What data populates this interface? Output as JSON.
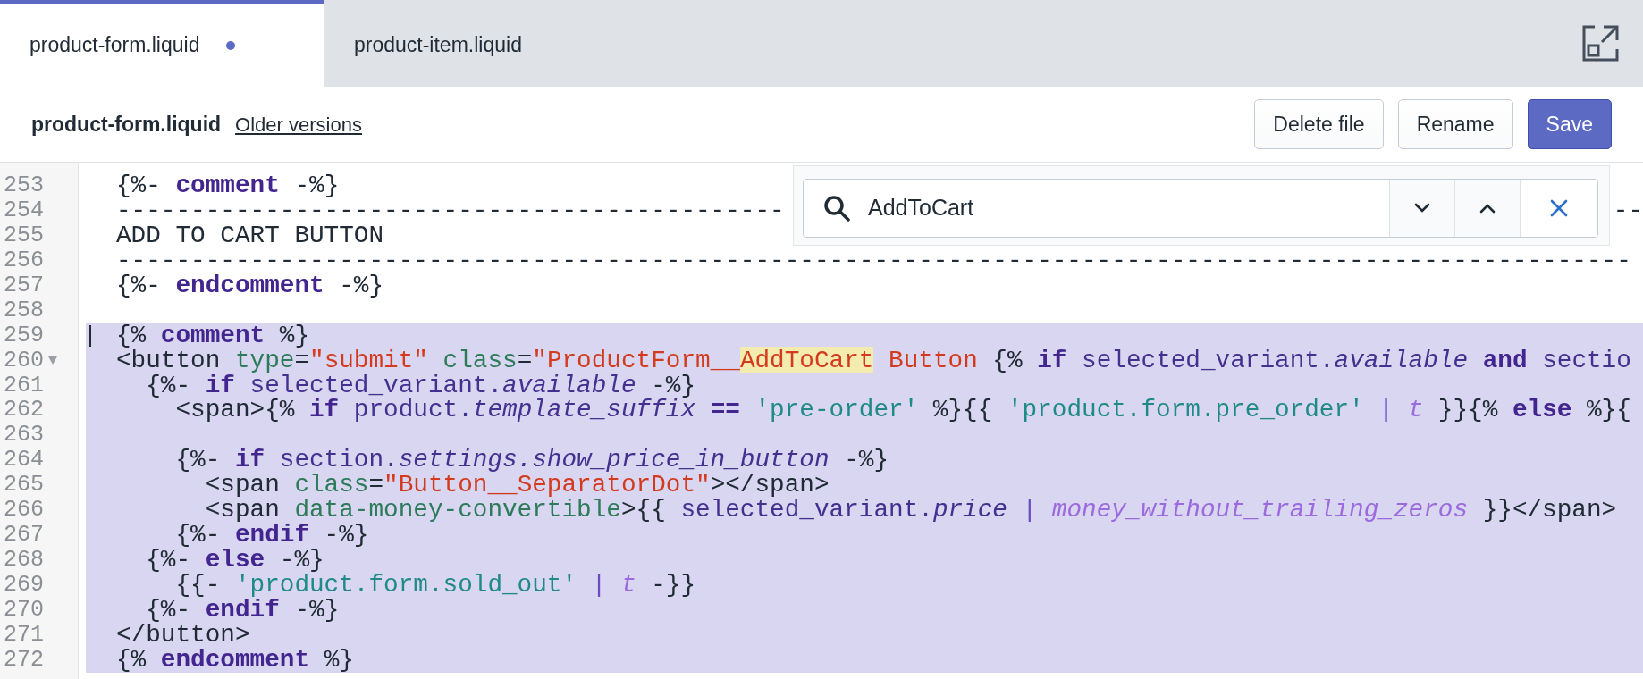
{
  "tabs": [
    {
      "label": "product-form.liquid",
      "selected": true,
      "modified": true
    },
    {
      "label": "product-item.liquid",
      "selected": false,
      "modified": false
    }
  ],
  "header": {
    "title": "product-form.liquid",
    "link": "Older versions",
    "buttons": [
      {
        "label": "Delete file",
        "kind": "secondary"
      },
      {
        "label": "Rename",
        "kind": "secondary"
      },
      {
        "label": "Save",
        "kind": "primary"
      }
    ]
  },
  "search": {
    "value": "AddToCart"
  },
  "lines": [
    {
      "number": "253",
      "selected": false,
      "fold": false,
      "cursor": false,
      "tokens": [
        {
          "kind": "plain",
          "t": "{%- "
        },
        {
          "kind": "kw",
          "t": "comment"
        },
        {
          "kind": "plain",
          "t": " -%}"
        }
      ]
    },
    {
      "number": "254",
      "selected": false,
      "fold": false,
      "cursor": false,
      "tokens": [
        {
          "kind": "plain",
          "t": "---------------------------------------------"
        },
        {
          "kind": "tail",
          "t": "--"
        }
      ]
    },
    {
      "number": "255",
      "selected": false,
      "fold": false,
      "cursor": false,
      "tokens": [
        {
          "kind": "plain",
          "t": "ADD TO CART BUTTON"
        }
      ]
    },
    {
      "number": "256",
      "selected": false,
      "fold": false,
      "cursor": false,
      "tokens": [
        {
          "kind": "plain",
          "t": "------------------------------------------------------------------------------------------------------"
        }
      ]
    },
    {
      "number": "257",
      "selected": false,
      "fold": false,
      "cursor": false,
      "tokens": [
        {
          "kind": "plain",
          "t": "{%- "
        },
        {
          "kind": "kw",
          "t": "endcomment"
        },
        {
          "kind": "plain",
          "t": " -%}"
        }
      ]
    },
    {
      "number": "258",
      "selected": false,
      "fold": false,
      "cursor": false
    },
    {
      "number": "259",
      "selected": true,
      "fold": false,
      "cursor": true,
      "tokens": [
        {
          "kind": "plain",
          "t": "{% "
        },
        {
          "kind": "kw",
          "t": "comment"
        },
        {
          "kind": "plain",
          "t": " %}"
        }
      ]
    },
    {
      "number": "260",
      "selected": true,
      "fold": true,
      "cursor": false,
      "tokens": [
        {
          "kind": "plain",
          "t": "<button "
        },
        {
          "kind": "attr",
          "t": "type"
        },
        {
          "kind": "plain",
          "t": "="
        },
        {
          "kind": "str",
          "t": "\"submit\" "
        },
        {
          "kind": "attr",
          "t": "class"
        },
        {
          "kind": "plain",
          "t": "="
        },
        {
          "kind": "str",
          "t": "\"ProductForm__"
        },
        {
          "kind": "match",
          "t": "AddToCart"
        },
        {
          "kind": "str",
          "t": " Button "
        },
        {
          "kind": "plain",
          "t": "{% "
        },
        {
          "kind": "kw",
          "t": "if"
        },
        {
          "kind": "var",
          "t": " selected_variant."
        },
        {
          "kind": "prop",
          "t": "available "
        },
        {
          "kind": "kw",
          "t": "and"
        },
        {
          "kind": "var",
          "t": " sectio"
        }
      ]
    },
    {
      "number": "261",
      "selected": true,
      "fold": false,
      "cursor": false,
      "tokens": [
        {
          "kind": "plain",
          "t": "  {%- "
        },
        {
          "kind": "kw",
          "t": "if"
        },
        {
          "kind": "var",
          "t": " selected_variant."
        },
        {
          "kind": "prop",
          "t": "available"
        },
        {
          "kind": "plain",
          "t": " -%}"
        }
      ]
    },
    {
      "number": "262",
      "selected": true,
      "fold": false,
      "cursor": false,
      "tokens": [
        {
          "kind": "plain",
          "t": "    <span>{% "
        },
        {
          "kind": "kw",
          "t": "if"
        },
        {
          "kind": "var",
          "t": " product."
        },
        {
          "kind": "prop",
          "t": "template_suffix "
        },
        {
          "kind": "kw",
          "t": "=="
        },
        {
          "kind": "str2",
          "t": " 'pre-order'"
        },
        {
          "kind": "plain",
          "t": " %}{{ "
        },
        {
          "kind": "str2",
          "t": "'product.form.pre_order' "
        },
        {
          "kind": "pipe",
          "t": "|"
        },
        {
          "kind": "filter",
          "t": " t"
        },
        {
          "kind": "plain",
          "t": " }}{% "
        },
        {
          "kind": "kw",
          "t": "else"
        },
        {
          "kind": "plain",
          "t": " %}{"
        }
      ]
    },
    {
      "number": "263",
      "selected": true,
      "fold": false,
      "cursor": false
    },
    {
      "number": "264",
      "selected": true,
      "fold": false,
      "cursor": false,
      "tokens": [
        {
          "kind": "plain",
          "t": "    {%- "
        },
        {
          "kind": "kw",
          "t": "if"
        },
        {
          "kind": "var",
          "t": " section."
        },
        {
          "kind": "prop",
          "t": "settings.show_price_in_button"
        },
        {
          "kind": "plain",
          "t": " -%}"
        }
      ]
    },
    {
      "number": "265",
      "selected": true,
      "fold": false,
      "cursor": false,
      "tokens": [
        {
          "kind": "plain",
          "t": "      <span "
        },
        {
          "kind": "attr",
          "t": "class"
        },
        {
          "kind": "plain",
          "t": "="
        },
        {
          "kind": "str",
          "t": "\"Button__SeparatorDot\""
        },
        {
          "kind": "plain",
          "t": "></span>"
        }
      ]
    },
    {
      "number": "266",
      "selected": true,
      "fold": false,
      "cursor": false,
      "tokens": [
        {
          "kind": "plain",
          "t": "      <span "
        },
        {
          "kind": "attr",
          "t": "data-money-convertible"
        },
        {
          "kind": "plain",
          "t": ">{{ "
        },
        {
          "kind": "var",
          "t": "selected_variant."
        },
        {
          "kind": "prop",
          "t": "price "
        },
        {
          "kind": "pipe",
          "t": "|"
        },
        {
          "kind": "filter",
          "t": " money_without_trailing_zeros"
        },
        {
          "kind": "plain",
          "t": " }}</span>"
        }
      ]
    },
    {
      "number": "267",
      "selected": true,
      "fold": false,
      "cursor": false,
      "tokens": [
        {
          "kind": "plain",
          "t": "    {%- "
        },
        {
          "kind": "kw",
          "t": "endif"
        },
        {
          "kind": "plain",
          "t": " -%}"
        }
      ]
    },
    {
      "number": "268",
      "selected": true,
      "fold": false,
      "cursor": false,
      "tokens": [
        {
          "kind": "plain",
          "t": "  {%- "
        },
        {
          "kind": "kw",
          "t": "else"
        },
        {
          "kind": "plain",
          "t": " -%}"
        }
      ]
    },
    {
      "number": "269",
      "selected": true,
      "fold": false,
      "cursor": false,
      "tokens": [
        {
          "kind": "plain",
          "t": "    {{- "
        },
        {
          "kind": "str2",
          "t": "'product.form.sold_out' "
        },
        {
          "kind": "pipe",
          "t": "|"
        },
        {
          "kind": "filter",
          "t": " t"
        },
        {
          "kind": "plain",
          "t": " -}}"
        }
      ]
    },
    {
      "number": "270",
      "selected": true,
      "fold": false,
      "cursor": false,
      "tokens": [
        {
          "kind": "plain",
          "t": "  {%- "
        },
        {
          "kind": "kw",
          "t": "endif"
        },
        {
          "kind": "plain",
          "t": " -%}"
        }
      ]
    },
    {
      "number": "271",
      "selected": true,
      "fold": false,
      "cursor": false,
      "tokens": [
        {
          "kind": "plain",
          "t": "</button>"
        }
      ]
    },
    {
      "number": "272",
      "selected": true,
      "fold": false,
      "cursor": false,
      "tokens": [
        {
          "kind": "plain",
          "t": "{% "
        },
        {
          "kind": "kw",
          "t": "endcomment"
        },
        {
          "kind": "plain",
          "t": " %}"
        }
      ]
    }
  ]
}
